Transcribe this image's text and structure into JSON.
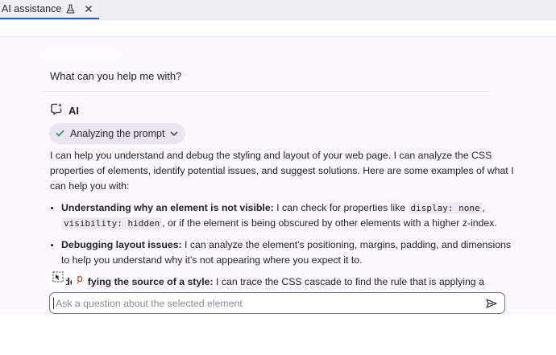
{
  "tab": {
    "label": "AI assistance",
    "icons": [
      "flask-icon",
      "close-icon"
    ]
  },
  "conversation": {
    "question": "What can you help me with?",
    "answer_author": "AI",
    "status_chip": "Analyzing the prompt",
    "intro": "I can help you understand and debug the styling and layout of your web page. I can analyze the CSS properties of elements, identify potential issues, and suggest solutions. Here are some examples of what I can help you with:",
    "bullets": [
      {
        "title": "Understanding why an element is not visible:",
        "text_a": " I can check for properties like ",
        "code_a": "display: none",
        "sep": ", ",
        "code_b": "visibility: hidden",
        "text_b": ", or if the element is being obscured by other elements with a higher z-index."
      },
      {
        "title": "Debugging layout issues:",
        "text": " I can analyze the element's positioning, margins, padding, and dimensions to help you understand why it's not appearing where you expect it to."
      },
      {
        "title": "Identifying the source of a style:",
        "text": " I can trace the CSS cascade to find the rule that is applying a specific style to"
      }
    ]
  },
  "context": {
    "element_tag": "p"
  },
  "input": {
    "placeholder": "Ask a question about the selected element",
    "value": ""
  },
  "colors": {
    "accent": "#1a5fc8",
    "chip_bg": "#e9e5f1",
    "panel_bg": "#fbf9fd",
    "tag_color": "#c0392b",
    "check_green": "#1e8e3e"
  }
}
